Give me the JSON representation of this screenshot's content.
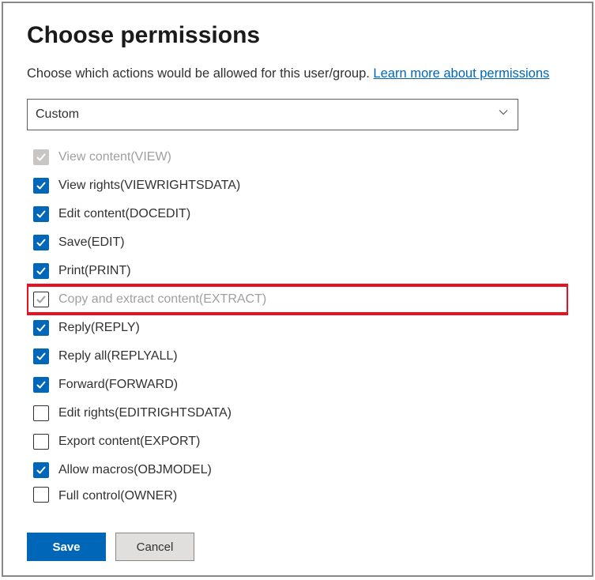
{
  "title": "Choose permissions",
  "description": "Choose which actions would be allowed for this user/group. ",
  "learn_more": "Learn more about permissions",
  "select": {
    "value": "Custom"
  },
  "permissions": [
    {
      "label": "View content(VIEW)",
      "checked": true,
      "disabled": true,
      "greyed": true
    },
    {
      "label": "View rights(VIEWRIGHTSDATA)",
      "checked": true,
      "disabled": false,
      "greyed": false
    },
    {
      "label": "Edit content(DOCEDIT)",
      "checked": true,
      "disabled": false,
      "greyed": false
    },
    {
      "label": "Save(EDIT)",
      "checked": true,
      "disabled": false,
      "greyed": false
    },
    {
      "label": "Print(PRINT)",
      "checked": true,
      "disabled": false,
      "greyed": false
    },
    {
      "label": "Copy and extract content(EXTRACT)",
      "checked": false,
      "disabled": false,
      "greyed": true,
      "highlight": true,
      "tick_grey": true
    },
    {
      "label": "Reply(REPLY)",
      "checked": true,
      "disabled": false,
      "greyed": false
    },
    {
      "label": "Reply all(REPLYALL)",
      "checked": true,
      "disabled": false,
      "greyed": false
    },
    {
      "label": "Forward(FORWARD)",
      "checked": true,
      "disabled": false,
      "greyed": false
    },
    {
      "label": "Edit rights(EDITRIGHTSDATA)",
      "checked": false,
      "disabled": false,
      "greyed": false
    },
    {
      "label": "Export content(EXPORT)",
      "checked": false,
      "disabled": false,
      "greyed": false
    },
    {
      "label": "Allow macros(OBJMODEL)",
      "checked": true,
      "disabled": false,
      "greyed": false
    },
    {
      "label": "Full control(OWNER)",
      "checked": false,
      "disabled": false,
      "greyed": false,
      "cutoff": true
    }
  ],
  "buttons": {
    "save": "Save",
    "cancel": "Cancel"
  }
}
